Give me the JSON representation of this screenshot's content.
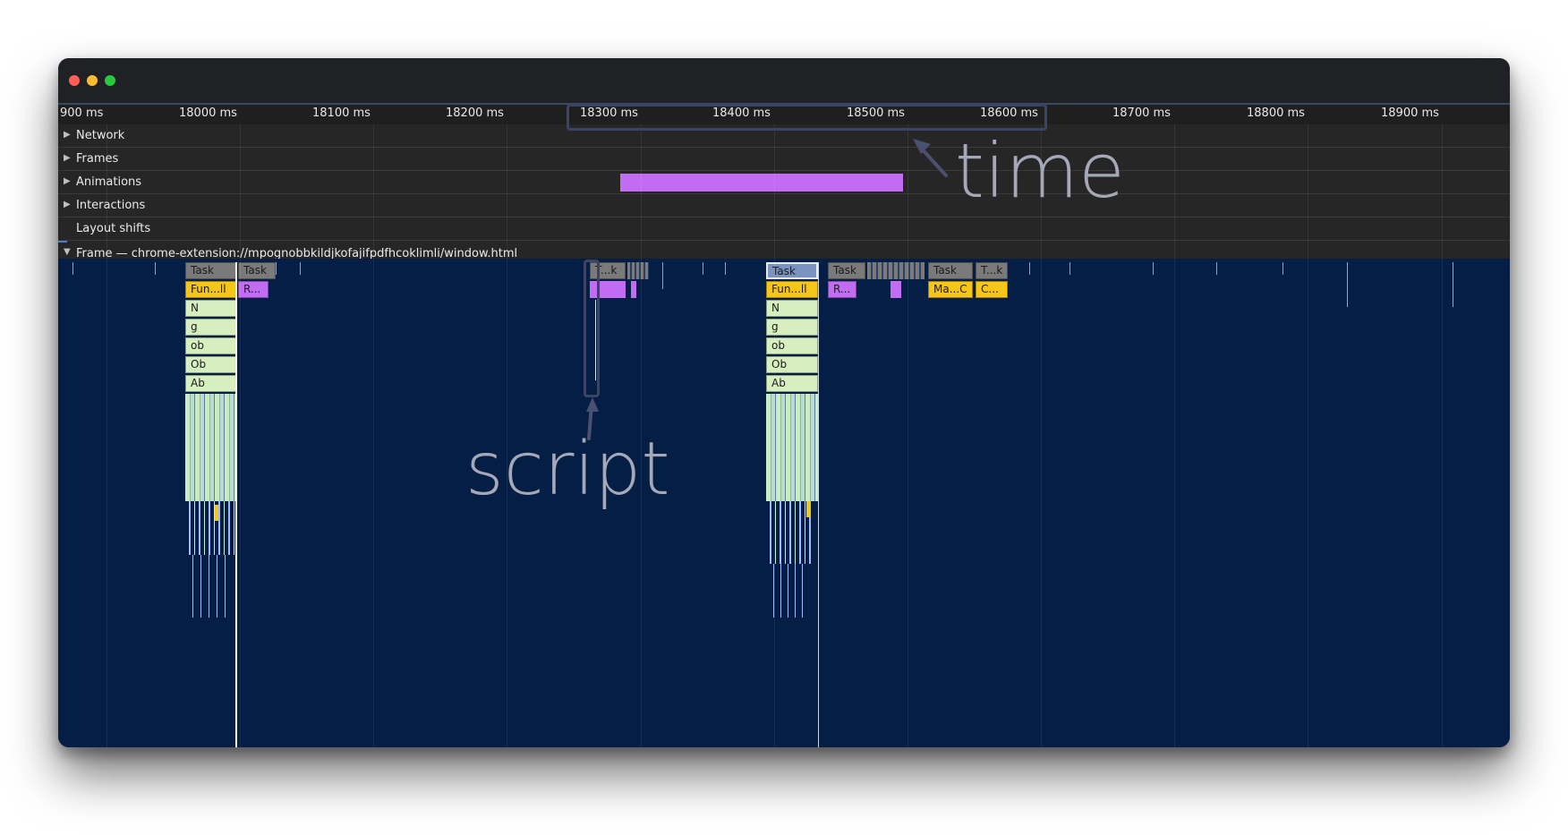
{
  "window": {
    "traffic_lights": [
      {
        "name": "close",
        "color": "#ff5f57"
      },
      {
        "name": "minimize",
        "color": "#febc2e"
      },
      {
        "name": "maximize",
        "color": "#28c840"
      }
    ]
  },
  "ruler": {
    "ticks": [
      "900 ms",
      "18000 ms",
      "18100 ms",
      "18200 ms",
      "18300 ms",
      "18400 ms",
      "18500 ms",
      "18600 ms",
      "18700 ms",
      "18800 ms",
      "18900 ms"
    ]
  },
  "tracks": {
    "network": "Network",
    "frames": "Frames",
    "animations": "Animations",
    "interactions": "Interactions",
    "layout_shifts": "Layout shifts",
    "frame": "Frame — chrome-extension://mpognobbkildjkofajifpdfhcoklimli/window.html"
  },
  "flame": {
    "task_1": "Task",
    "task_2": "Task",
    "task_3": "T...k",
    "task_4": "Task",
    "task_5": "Task",
    "task_6": "Task",
    "task_7": "T...k",
    "fn_1": "Fun...ll",
    "r_1": "R...",
    "fn_2": "Fun...ll",
    "r_2": "R...",
    "mac_1": "Ma...C",
    "c_1": "C...",
    "stack_1": [
      "N",
      "g",
      "ob",
      "Ob",
      "Ab"
    ],
    "stack_2": [
      "N",
      "g",
      "ob",
      "Ob",
      "Ab"
    ]
  },
  "colors": {
    "task": "#7a7a7a",
    "function": "#f5c518",
    "rendering": "#c26cf3",
    "script_stack": "#d7efbe",
    "flame_bg": "#041e45",
    "animation": "#c26cf3"
  },
  "annotations": {
    "time": "time",
    "script": "script"
  }
}
